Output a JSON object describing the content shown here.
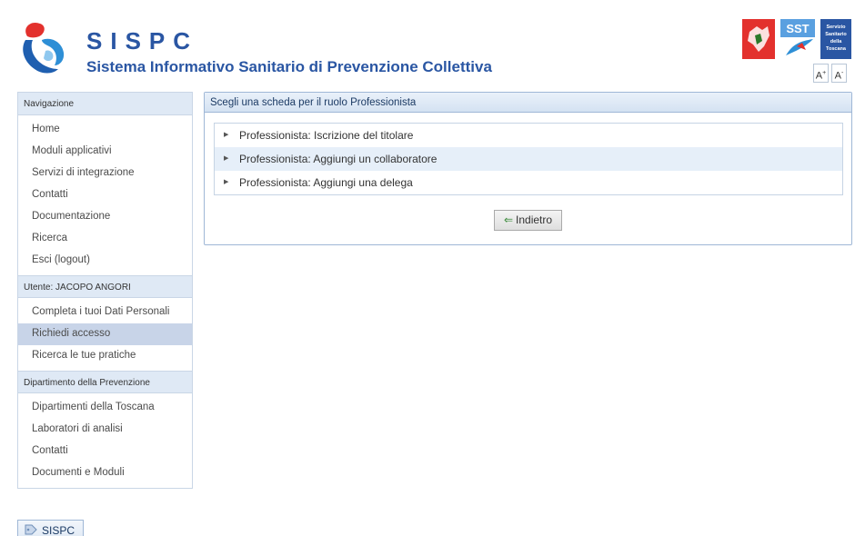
{
  "header": {
    "title": "SISPC",
    "subtitle": "Sistema Informativo Sanitario di Prevenzione Collettiva",
    "sst_label": "SST",
    "servizio_label": "Servizio Sanitario della Toscana",
    "font_increase": "A",
    "font_decrease": "A"
  },
  "sidebar": {
    "nav_header": "Navigazione",
    "nav_items": [
      "Home",
      "Moduli applicativi",
      "Servizi di integrazione",
      "Contatti",
      "Documentazione",
      "Ricerca",
      "Esci (logout)"
    ],
    "user_header": "Utente: JACOPO ANGORI",
    "user_items": [
      "Completa i tuoi Dati Personali",
      "Richiedi accesso",
      "Ricerca le tue pratiche"
    ],
    "dept_header": "Dipartimento della Prevenzione",
    "dept_items": [
      "Dipartimenti della Toscana",
      "Laboratori di analisi",
      "Contatti",
      "Documenti e Moduli"
    ]
  },
  "main": {
    "panel_title": "Scegli una scheda per il ruolo Professionista",
    "options": [
      "Professionista: Iscrizione del titolare",
      "Professionista: Aggiungi un collaboratore",
      "Professionista: Aggiungi una delega"
    ],
    "back_label": "Indietro"
  },
  "footer": {
    "tab_label": "SISPC"
  },
  "colors": {
    "brand_blue": "#2a56a3",
    "nav_header_bg": "#dfe9f5",
    "active_item_bg": "#c8d4e8",
    "option_alt_bg": "#e6eff9"
  }
}
